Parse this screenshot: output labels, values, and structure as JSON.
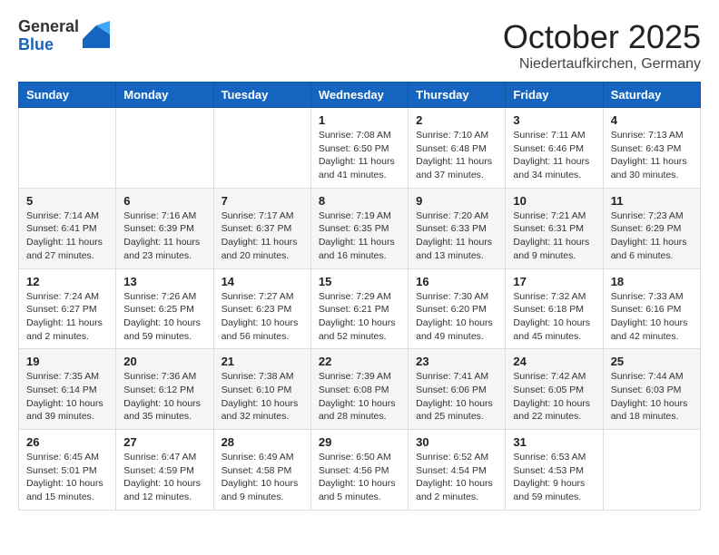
{
  "header": {
    "logo": {
      "general": "General",
      "blue": "Blue"
    },
    "month": "October 2025",
    "location": "Niedertaufkirchen, Germany"
  },
  "weekdays": [
    "Sunday",
    "Monday",
    "Tuesday",
    "Wednesday",
    "Thursday",
    "Friday",
    "Saturday"
  ],
  "weeks": [
    [
      {
        "day": "",
        "info": ""
      },
      {
        "day": "",
        "info": ""
      },
      {
        "day": "",
        "info": ""
      },
      {
        "day": "1",
        "info": "Sunrise: 7:08 AM\nSunset: 6:50 PM\nDaylight: 11 hours\nand 41 minutes."
      },
      {
        "day": "2",
        "info": "Sunrise: 7:10 AM\nSunset: 6:48 PM\nDaylight: 11 hours\nand 37 minutes."
      },
      {
        "day": "3",
        "info": "Sunrise: 7:11 AM\nSunset: 6:46 PM\nDaylight: 11 hours\nand 34 minutes."
      },
      {
        "day": "4",
        "info": "Sunrise: 7:13 AM\nSunset: 6:43 PM\nDaylight: 11 hours\nand 30 minutes."
      }
    ],
    [
      {
        "day": "5",
        "info": "Sunrise: 7:14 AM\nSunset: 6:41 PM\nDaylight: 11 hours\nand 27 minutes."
      },
      {
        "day": "6",
        "info": "Sunrise: 7:16 AM\nSunset: 6:39 PM\nDaylight: 11 hours\nand 23 minutes."
      },
      {
        "day": "7",
        "info": "Sunrise: 7:17 AM\nSunset: 6:37 PM\nDaylight: 11 hours\nand 20 minutes."
      },
      {
        "day": "8",
        "info": "Sunrise: 7:19 AM\nSunset: 6:35 PM\nDaylight: 11 hours\nand 16 minutes."
      },
      {
        "day": "9",
        "info": "Sunrise: 7:20 AM\nSunset: 6:33 PM\nDaylight: 11 hours\nand 13 minutes."
      },
      {
        "day": "10",
        "info": "Sunrise: 7:21 AM\nSunset: 6:31 PM\nDaylight: 11 hours\nand 9 minutes."
      },
      {
        "day": "11",
        "info": "Sunrise: 7:23 AM\nSunset: 6:29 PM\nDaylight: 11 hours\nand 6 minutes."
      }
    ],
    [
      {
        "day": "12",
        "info": "Sunrise: 7:24 AM\nSunset: 6:27 PM\nDaylight: 11 hours\nand 2 minutes."
      },
      {
        "day": "13",
        "info": "Sunrise: 7:26 AM\nSunset: 6:25 PM\nDaylight: 10 hours\nand 59 minutes."
      },
      {
        "day": "14",
        "info": "Sunrise: 7:27 AM\nSunset: 6:23 PM\nDaylight: 10 hours\nand 56 minutes."
      },
      {
        "day": "15",
        "info": "Sunrise: 7:29 AM\nSunset: 6:21 PM\nDaylight: 10 hours\nand 52 minutes."
      },
      {
        "day": "16",
        "info": "Sunrise: 7:30 AM\nSunset: 6:20 PM\nDaylight: 10 hours\nand 49 minutes."
      },
      {
        "day": "17",
        "info": "Sunrise: 7:32 AM\nSunset: 6:18 PM\nDaylight: 10 hours\nand 45 minutes."
      },
      {
        "day": "18",
        "info": "Sunrise: 7:33 AM\nSunset: 6:16 PM\nDaylight: 10 hours\nand 42 minutes."
      }
    ],
    [
      {
        "day": "19",
        "info": "Sunrise: 7:35 AM\nSunset: 6:14 PM\nDaylight: 10 hours\nand 39 minutes."
      },
      {
        "day": "20",
        "info": "Sunrise: 7:36 AM\nSunset: 6:12 PM\nDaylight: 10 hours\nand 35 minutes."
      },
      {
        "day": "21",
        "info": "Sunrise: 7:38 AM\nSunset: 6:10 PM\nDaylight: 10 hours\nand 32 minutes."
      },
      {
        "day": "22",
        "info": "Sunrise: 7:39 AM\nSunset: 6:08 PM\nDaylight: 10 hours\nand 28 minutes."
      },
      {
        "day": "23",
        "info": "Sunrise: 7:41 AM\nSunset: 6:06 PM\nDaylight: 10 hours\nand 25 minutes."
      },
      {
        "day": "24",
        "info": "Sunrise: 7:42 AM\nSunset: 6:05 PM\nDaylight: 10 hours\nand 22 minutes."
      },
      {
        "day": "25",
        "info": "Sunrise: 7:44 AM\nSunset: 6:03 PM\nDaylight: 10 hours\nand 18 minutes."
      }
    ],
    [
      {
        "day": "26",
        "info": "Sunrise: 6:45 AM\nSunset: 5:01 PM\nDaylight: 10 hours\nand 15 minutes."
      },
      {
        "day": "27",
        "info": "Sunrise: 6:47 AM\nSunset: 4:59 PM\nDaylight: 10 hours\nand 12 minutes."
      },
      {
        "day": "28",
        "info": "Sunrise: 6:49 AM\nSunset: 4:58 PM\nDaylight: 10 hours\nand 9 minutes."
      },
      {
        "day": "29",
        "info": "Sunrise: 6:50 AM\nSunset: 4:56 PM\nDaylight: 10 hours\nand 5 minutes."
      },
      {
        "day": "30",
        "info": "Sunrise: 6:52 AM\nSunset: 4:54 PM\nDaylight: 10 hours\nand 2 minutes."
      },
      {
        "day": "31",
        "info": "Sunrise: 6:53 AM\nSunset: 4:53 PM\nDaylight: 9 hours\nand 59 minutes."
      },
      {
        "day": "",
        "info": ""
      }
    ]
  ]
}
